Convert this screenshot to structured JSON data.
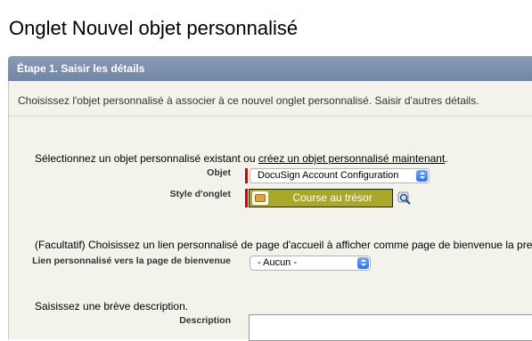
{
  "page": {
    "title": "Onglet Nouvel objet personnalisé"
  },
  "step": {
    "header": "Étape 1. Saisir les détails"
  },
  "instructions": "Choisissez l'objet personnalisé à associer à ce nouvel onglet personnalisé. Saisir d'autres détails.",
  "object_section": {
    "prompt_prefix": "Sélectionnez un objet personnalisé existant ou ",
    "create_link": "créez un objet personnalisé maintenant",
    "prompt_suffix": ".",
    "object_label": "Objet",
    "object_value": "DocuSign Account Configuration",
    "tab_style_label": "Style d'onglet",
    "tab_style_value": "Course au trésor",
    "tab_style_color": "#a9a82a",
    "tab_style_icon": "treasure-chest-icon",
    "lookup_icon": "magnifier-lookup-icon"
  },
  "splash_section": {
    "prompt": "(Facultatif) Choisissez un lien personnalisé de page d'accueil à afficher comme page de bienvenue la pre",
    "label": "Lien personnalisé vers la page de bienvenue",
    "value": "- Aucun -"
  },
  "description_section": {
    "prompt": "Saisissez une brève description.",
    "label": "Description",
    "value": ""
  },
  "colors": {
    "header_bg": "#7f92b0",
    "panel_bg": "#f3f3ec",
    "required": "#cc0000",
    "select_arrow": "#2f74e8"
  }
}
